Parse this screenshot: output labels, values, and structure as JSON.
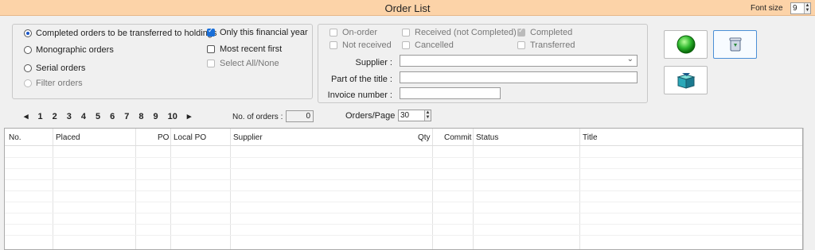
{
  "window": {
    "title": "Order List",
    "font_size_label": "Font size",
    "font_size_value": "9"
  },
  "options": {
    "radios": [
      {
        "label": "Completed orders to be transferred to holdings",
        "checked": true,
        "disabled": false
      },
      {
        "label": "Monographic orders",
        "checked": false,
        "disabled": false
      },
      {
        "label": "Serial orders",
        "checked": false,
        "disabled": false
      },
      {
        "label": "Filter orders",
        "checked": false,
        "disabled": true
      }
    ],
    "checks": [
      {
        "label": "Only this financial year",
        "checked": true
      },
      {
        "label": "Most recent first",
        "checked": false
      },
      {
        "label": "Select All/None",
        "checked": false,
        "disabled": true
      }
    ]
  },
  "filter": {
    "status_checks": [
      {
        "label": "On-order"
      },
      {
        "label": "Not received"
      },
      {
        "label": "Received (not Completed)"
      },
      {
        "label": "Cancelled"
      },
      {
        "label": "Completed",
        "ghost_checked": true
      },
      {
        "label": "Transferred"
      }
    ],
    "supplier_label": "Supplier :",
    "supplier_value": "",
    "title_part_label": "Part of the title :",
    "title_part_value": "",
    "invoice_label": "Invoice number :",
    "invoice_value": ""
  },
  "pager": {
    "prev": "◂",
    "pages": [
      "1",
      "2",
      "3",
      "4",
      "5",
      "6",
      "7",
      "8",
      "9",
      "10"
    ],
    "next": "▸",
    "no_orders_label": "No. of orders :",
    "no_orders_value": "0",
    "orders_per_page_label": "Orders/Page :",
    "orders_per_page_value": "30"
  },
  "buttons": {
    "go_icon": "green-circle-icon",
    "clear_icon": "recycle-bin-icon",
    "transfer_icon": "box-transfer-icon"
  },
  "table": {
    "columns": [
      "No.",
      "Placed",
      "PO",
      "Local PO",
      "Supplier",
      "Qty",
      "Commit",
      "Status",
      "Title"
    ]
  }
}
